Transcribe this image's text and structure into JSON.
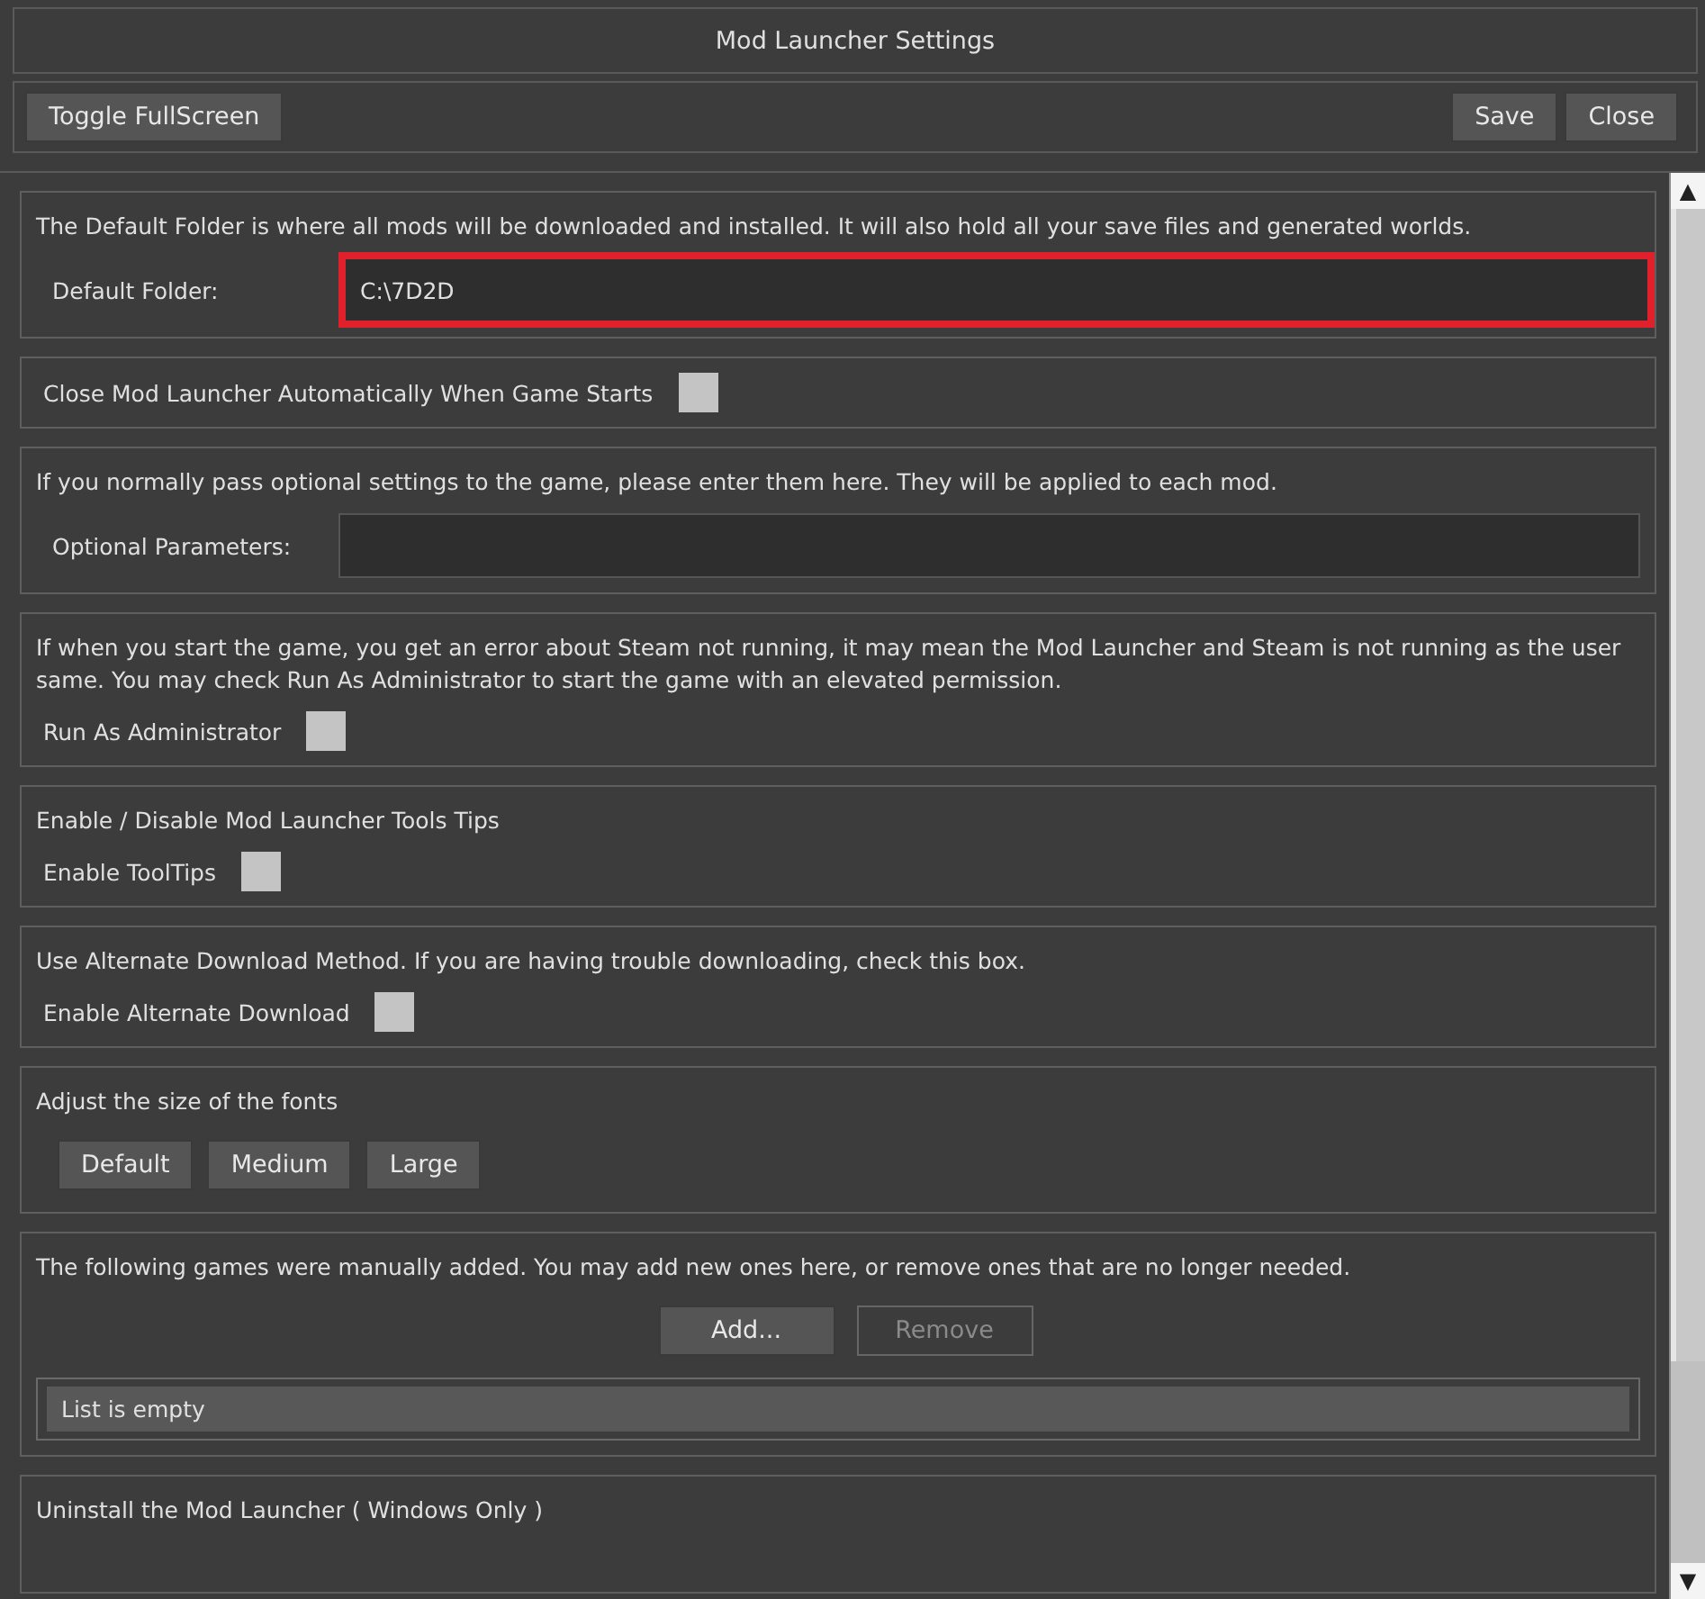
{
  "window": {
    "title": "Mod Launcher Settings"
  },
  "toolbar": {
    "left_buttons": [
      "Toggle FullScreen"
    ],
    "right_buttons": [
      "Save",
      "Close"
    ]
  },
  "sections": [
    {
      "kind": "field",
      "description": "The Default Folder is where all mods will be downloaded and installed. It will also hold all your save files and generated worlds.",
      "label": "Default Folder:",
      "value": "C:\\7D2D",
      "highlighted": true
    },
    {
      "kind": "checkbox",
      "label": "Close Mod Launcher Automatically When Game Starts",
      "checked": false
    },
    {
      "kind": "field",
      "description": "If you normally pass optional settings to the game, please enter them here. They will be applied to each mod.",
      "label": "Optional Parameters:",
      "highlighted": false
    },
    {
      "kind": "checkbox",
      "description": "If when you start the game, you get an error about Steam not running, it may mean the Mod Launcher and Steam is not running as the user same. You may check Run As Administrator to start the game with an elevated permission.",
      "label": "Run As Administrator",
      "checked": false
    },
    {
      "kind": "checkbox",
      "description": "Enable / Disable Mod Launcher Tools Tips",
      "label": "Enable ToolTips",
      "checked": false
    },
    {
      "kind": "checkbox",
      "description": "Use Alternate Download Method.  If you are having trouble downloading, check this box.",
      "label": "Enable Alternate Download",
      "checked": false
    },
    {
      "kind": "buttons",
      "description": "Adjust the size of the fonts",
      "buttons": [
        {
          "label": "Default",
          "disabled": false
        },
        {
          "label": "Medium",
          "disabled": false
        },
        {
          "label": "Large",
          "disabled": false
        }
      ]
    },
    {
      "kind": "list",
      "description": "The following games were manually added. You may add new ones here, or remove ones that are no longer needed.",
      "buttons": [
        {
          "label": "Add...",
          "disabled": false
        },
        {
          "label": "Remove",
          "disabled": true
        }
      ],
      "empty_text": "List is empty"
    },
    {
      "kind": "text",
      "description": "Uninstall the Mod Launcher ( Windows Only )"
    }
  ],
  "scrollbar": {
    "up": "▲",
    "down": "▼"
  }
}
